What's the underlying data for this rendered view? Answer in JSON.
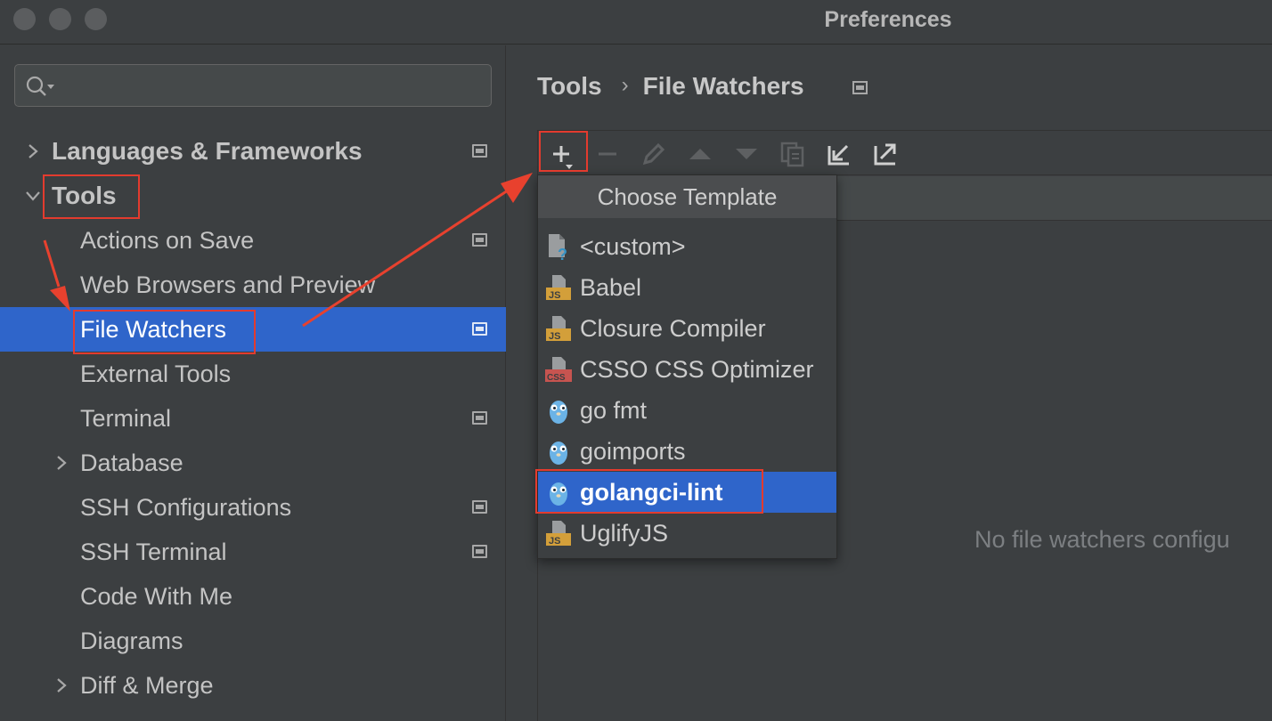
{
  "window": {
    "title": "Preferences"
  },
  "sidebar": {
    "search": {
      "value": "",
      "placeholder": ""
    },
    "items": [
      {
        "label": "Languages & Frameworks"
      },
      {
        "label": "Tools"
      },
      {
        "label": "Actions on Save"
      },
      {
        "label": "Web Browsers and Preview"
      },
      {
        "label": "File Watchers"
      },
      {
        "label": "External Tools"
      },
      {
        "label": "Terminal"
      },
      {
        "label": "Database"
      },
      {
        "label": "SSH Configurations"
      },
      {
        "label": "SSH Terminal"
      },
      {
        "label": "Code With Me"
      },
      {
        "label": "Diagrams"
      },
      {
        "label": "Diff & Merge"
      }
    ]
  },
  "breadcrumb": {
    "parent": "Tools",
    "separator": "›",
    "current": "File Watchers"
  },
  "toolbar": {
    "icons": [
      "add-icon",
      "remove-icon",
      "edit-icon",
      "move-up-icon",
      "move-down-icon",
      "copy-icon",
      "import-icon",
      "export-icon"
    ]
  },
  "main": {
    "empty_text": "No file watchers configu"
  },
  "popup": {
    "title": "Choose Template",
    "items": [
      {
        "label": "<custom>",
        "icon": "custom-file-icon"
      },
      {
        "label": "Babel",
        "icon": "js-file-icon"
      },
      {
        "label": "Closure Compiler",
        "icon": "js-file-icon"
      },
      {
        "label": "CSSO CSS Optimizer",
        "icon": "css-file-icon"
      },
      {
        "label": "go fmt",
        "icon": "gopher-icon"
      },
      {
        "label": "goimports",
        "icon": "gopher-icon"
      },
      {
        "label": "golangci-lint",
        "icon": "gopher-icon"
      },
      {
        "label": "UglifyJS",
        "icon": "js-file-icon"
      }
    ]
  },
  "colors": {
    "selection": "#2f65ca",
    "annotation": "#e33b2e",
    "background": "#3c3f41"
  }
}
